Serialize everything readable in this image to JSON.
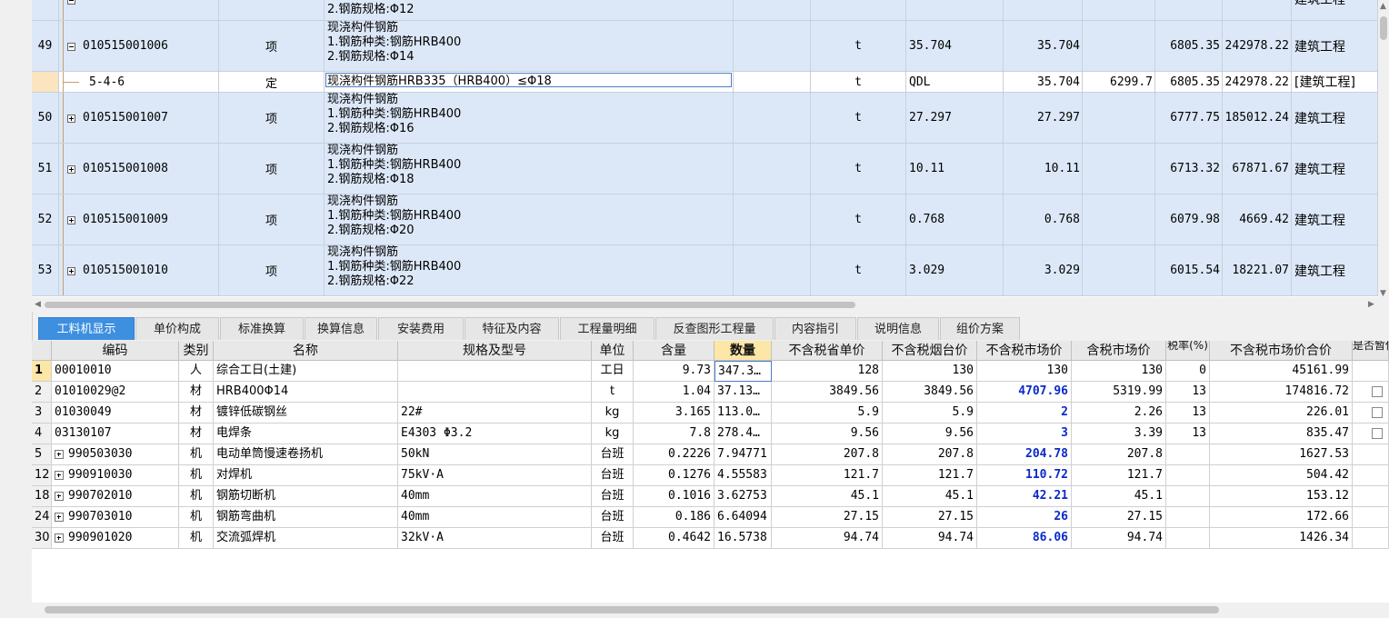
{
  "top_grid": {
    "rows": [
      {
        "no": "",
        "code": "",
        "kind": "",
        "desc": [
          "2.钢筋规格:Φ12"
        ],
        "unit": "",
        "qty_expr": "",
        "qty": "",
        "price1": "",
        "price2": "",
        "total": "",
        "type": "建筑工程",
        "expand": "minus",
        "partial": true
      },
      {
        "no": "49",
        "code": "010515001006",
        "kind": "项",
        "desc": [
          "现浇构件钢筋",
          "1.钢筋种类:钢筋HRB400",
          "2.钢筋规格:Φ14"
        ],
        "unit": "t",
        "qty_expr": "35.704",
        "qty": "35.704",
        "price1": "",
        "price2": "6805.35",
        "total": "242978.22",
        "type": "建筑工程",
        "expand": "minus"
      },
      {
        "no": "",
        "code": "5-4-6",
        "kind": "定",
        "desc": [
          "现浇构件钢筋HRB335（HRB400）≤Φ18"
        ],
        "unit": "t",
        "qty_expr": "QDL",
        "qty": "35.704",
        "price1": "6299.7",
        "price2": "6805.35",
        "total": "242978.22",
        "type": "[建筑工程]",
        "sub": true
      },
      {
        "no": "50",
        "code": "010515001007",
        "kind": "项",
        "desc": [
          "现浇构件钢筋",
          "1.钢筋种类:钢筋HRB400",
          "2.钢筋规格:Φ16"
        ],
        "unit": "t",
        "qty_expr": "27.297",
        "qty": "27.297",
        "price1": "",
        "price2": "6777.75",
        "total": "185012.24",
        "type": "建筑工程",
        "expand": "plus"
      },
      {
        "no": "51",
        "code": "010515001008",
        "kind": "项",
        "desc": [
          "现浇构件钢筋",
          "1.钢筋种类:钢筋HRB400",
          "2.钢筋规格:Φ18"
        ],
        "unit": "t",
        "qty_expr": "10.11",
        "qty": "10.11",
        "price1": "",
        "price2": "6713.32",
        "total": "67871.67",
        "type": "建筑工程",
        "expand": "plus"
      },
      {
        "no": "52",
        "code": "010515001009",
        "kind": "项",
        "desc": [
          "现浇构件钢筋",
          "1.钢筋种类:钢筋HRB400",
          "2.钢筋规格:Φ20"
        ],
        "unit": "t",
        "qty_expr": "0.768",
        "qty": "0.768",
        "price1": "",
        "price2": "6079.98",
        "total": "4669.42",
        "type": "建筑工程",
        "expand": "plus"
      },
      {
        "no": "53",
        "code": "010515001010",
        "kind": "项",
        "desc": [
          "现浇构件钢筋",
          "1.钢筋种类:钢筋HRB400",
          "2.钢筋规格:Φ22"
        ],
        "unit": "t",
        "qty_expr": "3.029",
        "qty": "3.029",
        "price1": "",
        "price2": "6015.54",
        "total": "18221.07",
        "type": "建筑工程",
        "expand": "plus"
      }
    ]
  },
  "tabs": [
    {
      "label": "工料机显示",
      "active": true
    },
    {
      "label": "单价构成"
    },
    {
      "label": "标准换算"
    },
    {
      "label": "换算信息"
    },
    {
      "label": "安装费用"
    },
    {
      "label": "特征及内容"
    },
    {
      "label": "工程量明细"
    },
    {
      "label": "反查图形工程量"
    },
    {
      "label": "内容指引"
    },
    {
      "label": "说明信息"
    },
    {
      "label": "组价方案"
    }
  ],
  "bottom_grid": {
    "headers": [
      "",
      "编码",
      "类别",
      "名称",
      "规格及型号",
      "单位",
      "含量",
      "数量",
      "不含税省单价",
      "不含税烟台价",
      "不含税市场价",
      "含税市场价",
      "税率(%)",
      "不含税市场价合价",
      "是否暂估"
    ],
    "rows": [
      {
        "no": "1",
        "code": "00010010",
        "cat": "人",
        "name": "综合工日(土建)",
        "spec": "",
        "unit": "工日",
        "content": "9.73",
        "qty": "347.3…",
        "p1": "128",
        "p2": "130",
        "p3": "130",
        "p4": "130",
        "tax": "0",
        "total": "45161.99",
        "blue": false,
        "check": false,
        "current": true
      },
      {
        "no": "2",
        "code": "01010029@2",
        "cat": "材",
        "name": "HRB400Φ14",
        "spec": "",
        "unit": "t",
        "content": "1.04",
        "qty": "37.13…",
        "p1": "3849.56",
        "p2": "3849.56",
        "p3": "4707.96",
        "p4": "5319.99",
        "tax": "13",
        "total": "174816.72",
        "blue": true,
        "check": true
      },
      {
        "no": "3",
        "code": "01030049",
        "cat": "材",
        "name": "镀锌低碳钢丝",
        "spec": "22#",
        "unit": "kg",
        "content": "3.165",
        "qty": "113.0…",
        "p1": "5.9",
        "p2": "5.9",
        "p3": "2",
        "p4": "2.26",
        "tax": "13",
        "total": "226.01",
        "blue": true,
        "check": true
      },
      {
        "no": "4",
        "code": "03130107",
        "cat": "材",
        "name": "电焊条",
        "spec": "E4303 Φ3.2",
        "unit": "kg",
        "content": "7.8",
        "qty": "278.4…",
        "p1": "9.56",
        "p2": "9.56",
        "p3": "3",
        "p4": "3.39",
        "tax": "13",
        "total": "835.47",
        "blue": true,
        "check": true
      },
      {
        "no": "5",
        "code": "990503030",
        "cat": "机",
        "name": "电动单筒慢速卷扬机",
        "spec": "50kN",
        "unit": "台班",
        "content": "0.2226",
        "qty": "7.94771",
        "p1": "207.8",
        "p2": "207.8",
        "p3": "204.78",
        "p4": "207.8",
        "tax": "",
        "total": "1627.53",
        "blue": true,
        "expand": true
      },
      {
        "no": "12",
        "code": "990910030",
        "cat": "机",
        "name": "对焊机",
        "spec": "75kV·A",
        "unit": "台班",
        "content": "0.1276",
        "qty": "4.55583",
        "p1": "121.7",
        "p2": "121.7",
        "p3": "110.72",
        "p4": "121.7",
        "tax": "",
        "total": "504.42",
        "blue": true,
        "expand": true
      },
      {
        "no": "18",
        "code": "990702010",
        "cat": "机",
        "name": "钢筋切断机",
        "spec": "40mm",
        "unit": "台班",
        "content": "0.1016",
        "qty": "3.62753",
        "p1": "45.1",
        "p2": "45.1",
        "p3": "42.21",
        "p4": "45.1",
        "tax": "",
        "total": "153.12",
        "blue": true,
        "expand": true
      },
      {
        "no": "24",
        "code": "990703010",
        "cat": "机",
        "name": "钢筋弯曲机",
        "spec": "40mm",
        "unit": "台班",
        "content": "0.186",
        "qty": "6.64094",
        "p1": "27.15",
        "p2": "27.15",
        "p3": "26",
        "p4": "27.15",
        "tax": "",
        "total": "172.66",
        "blue": true,
        "expand": true
      },
      {
        "no": "30",
        "code": "990901020",
        "cat": "机",
        "name": "交流弧焊机",
        "spec": "32kV·A",
        "unit": "台班",
        "content": "0.4642",
        "qty": "16.5738",
        "p1": "94.74",
        "p2": "94.74",
        "p3": "86.06",
        "p4": "94.74",
        "tax": "",
        "total": "1426.34",
        "blue": true,
        "expand": true
      }
    ]
  }
}
